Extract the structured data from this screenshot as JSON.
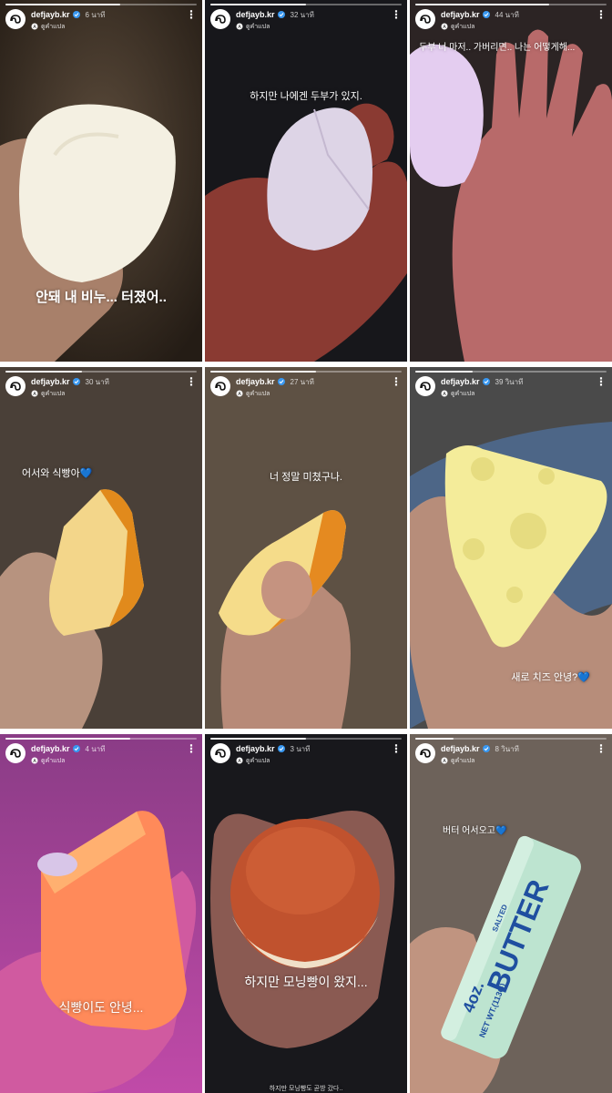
{
  "username": "defjayb.kr",
  "translate_label": "ดูคำแปล",
  "more_icon": "⋮",
  "stories": [
    {
      "time": "6 นาที",
      "caption": "안돼 내 비누... 터졌어..",
      "progress": 0.6
    },
    {
      "time": "32 นาที",
      "caption": "하지만 나에겐 두부가 있지.",
      "progress": 0.5
    },
    {
      "time": "44 นาที",
      "caption": "두부 너 마저.. 가버리면.. 나는 어떻게해...",
      "progress": 0.7
    },
    {
      "time": "30 นาที",
      "caption": "어서와 식빵아💙",
      "progress": 0.4
    },
    {
      "time": "27 นาที",
      "caption": "너 정말 미쳤구나.",
      "progress": 0.55
    },
    {
      "time": "39 วินาที",
      "caption": "새로 치즈 안녕?💙",
      "progress": 0.3
    },
    {
      "time": "4 นาที",
      "caption": "식빵이도 안녕...",
      "progress": 0.65
    },
    {
      "time": "3 นาที",
      "caption": "하지만 모닝빵이 왔지...",
      "caption2": "하지만 모닝빵도 곧방 갔다..",
      "progress": 0.5
    },
    {
      "time": "8 วินาที",
      "caption": "버터 어서오고💙",
      "progress": 0.2
    }
  ],
  "butter": {
    "brand": "BUTTER",
    "salted": "SALTED",
    "weight": "4oz.",
    "net": "NET WT.(113G)"
  },
  "colors": {
    "verified": "#3897f0"
  }
}
